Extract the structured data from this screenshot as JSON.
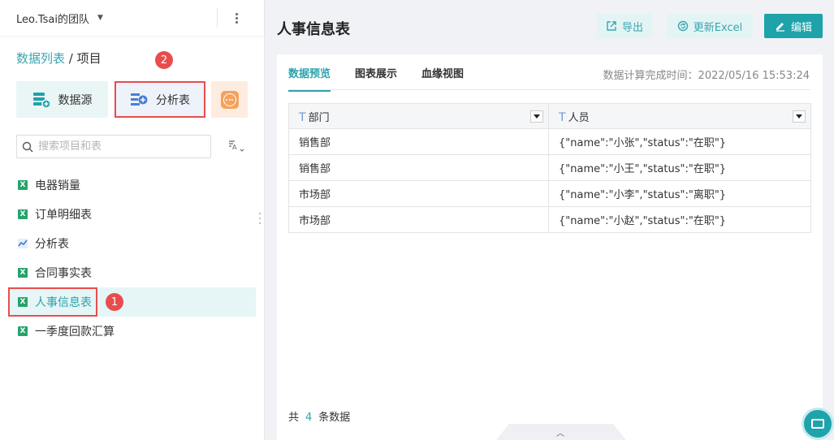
{
  "sidebar": {
    "team_name": "Leo.Tsai的团队",
    "breadcrumb": {
      "root": "数据列表",
      "separator": "/",
      "current": "项目"
    },
    "tiles": {
      "datasource": "数据源",
      "analysis": "分析表"
    },
    "badges": {
      "first": "1",
      "second": "2"
    },
    "search_placeholder": "搜索项目和表",
    "items": [
      {
        "label": "电器销量",
        "icon": "excel-icon"
      },
      {
        "label": "订单明细表",
        "icon": "excel-icon"
      },
      {
        "label": "分析表",
        "icon": "line-chart-icon"
      },
      {
        "label": "合同事实表",
        "icon": "excel-icon"
      },
      {
        "label": "人事信息表",
        "icon": "excel-icon",
        "active": true
      },
      {
        "label": "一季度回款汇算",
        "icon": "excel-icon"
      }
    ]
  },
  "main": {
    "title": "人事信息表",
    "buttons": {
      "export": "导出",
      "update": "更新Excel",
      "edit": "编辑"
    },
    "tabs": [
      "数据预览",
      "图表展示",
      "血缘视图"
    ],
    "calc_time": "数据计算完成时间：2022/05/16 15:53:24",
    "table": {
      "columns": [
        "部门",
        "人员"
      ],
      "rows": [
        [
          "销售部",
          "{\"name\":\"小张\",\"status\":\"在职\"}"
        ],
        [
          "销售部",
          "{\"name\":\"小王\",\"status\":\"在职\"}"
        ],
        [
          "市场部",
          "{\"name\":\"小李\",\"status\":\"离职\"}"
        ],
        [
          "市场部",
          "{\"name\":\"小赵\",\"status\":\"在职\"}"
        ]
      ]
    },
    "footer": {
      "prefix": "共",
      "count": "4",
      "suffix": "条数据"
    }
  },
  "colors": {
    "accent": "#1ea3ab",
    "highlight": "#e84d4d",
    "excel": "#26a36a"
  }
}
